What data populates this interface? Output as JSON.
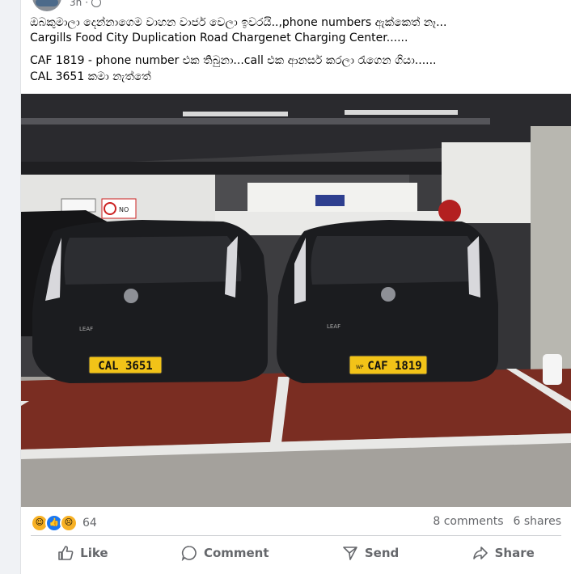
{
  "post": {
    "time": "3h",
    "lines": [
      "ඔබකුමාලා දෙන්නාගෙම වාහන වාජර් වෙලා ඉවරයි..,phone numbers ඇක්කෙත් නෑ...",
      "Cargills Food City Duplication Road Chargenet Charging Center......",
      "CAF 1819 - phone number එක තිබුනා...call එක ආනසර් කරලා රැගෙන ගියා......",
      "CAL 3651 කමා නැත්තේ"
    ]
  },
  "photo": {
    "plate_left": "CAL 3651",
    "plate_right": "CAF 1819",
    "plate_right_prefix": "WP",
    "car_badge": "LEAF",
    "sign_no": "NO",
    "plate_color": "#f2c318"
  },
  "stats": {
    "reaction_count": "64",
    "comments": "8 comments",
    "shares": "6 shares",
    "reactions": [
      "haha",
      "like",
      "sad"
    ]
  },
  "actions": {
    "like": "Like",
    "comment": "Comment",
    "send": "Send",
    "share": "Share"
  }
}
